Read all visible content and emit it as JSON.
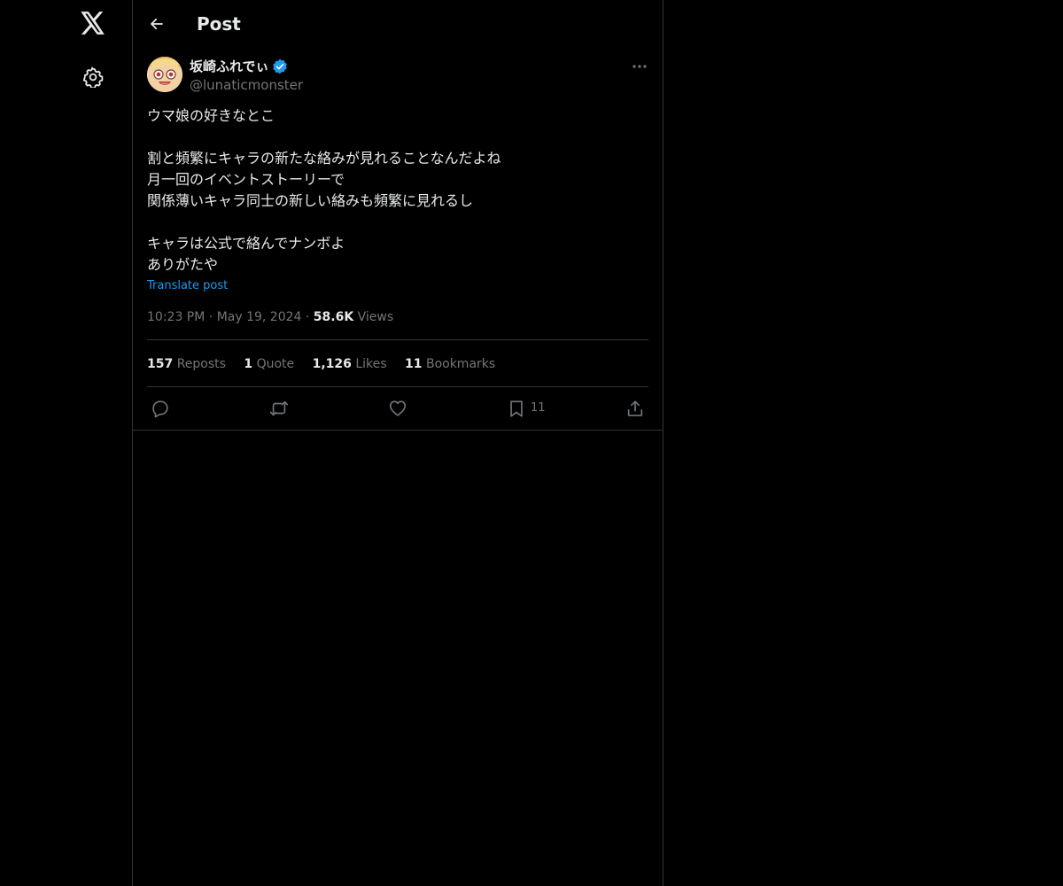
{
  "nav": {
    "logo_icon": "x-logo-icon",
    "settings_icon": "gear-icon"
  },
  "header": {
    "back_icon": "arrow-left-icon",
    "title": "Post"
  },
  "post": {
    "author": {
      "name": "坂崎ふれでぃ",
      "handle": "@lunaticmonster",
      "verified": true,
      "verified_color": "#1d9bf0"
    },
    "text_lines": [
      "ウマ娘の好きなとこ",
      "",
      "割と頻繁にキャラの新たな絡みが見れることなんだよね",
      "月一回のイベントストーリーで",
      "関係薄いキャラ同士の新しい絡みも頻繁に見れるし",
      "",
      "キャラは公式で絡んでナンボよ",
      "ありがたや"
    ],
    "translate_label": "Translate post",
    "time": "10:23 PM",
    "date": "May 19, 2024",
    "views_count": "58.6K",
    "views_label": "Views",
    "stats": {
      "reposts_count": "157",
      "reposts_label": "Reposts",
      "quotes_count": "1",
      "quotes_label": "Quote",
      "likes_count": "1,126",
      "likes_label": "Likes",
      "bookmarks_count": "11",
      "bookmarks_label": "Bookmarks"
    },
    "actions": {
      "reply_icon": "reply-icon",
      "repost_icon": "repost-icon",
      "like_icon": "heart-icon",
      "bookmark_icon": "bookmark-icon",
      "bookmark_count": "11",
      "share_icon": "share-icon"
    }
  },
  "colors": {
    "background": "#000000",
    "text_primary": "#e7e9ea",
    "text_secondary": "#71767b",
    "accent": "#1d9bf0",
    "border": "#2f3336"
  }
}
